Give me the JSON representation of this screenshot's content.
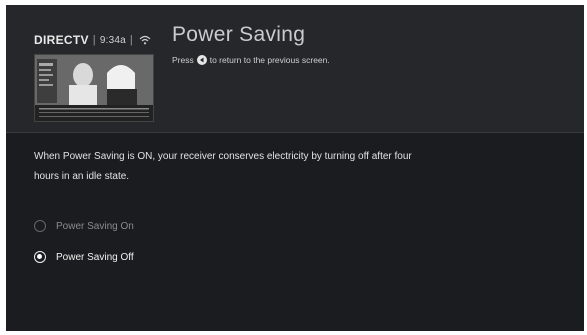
{
  "header": {
    "brand": "DIRECTV",
    "separator": "|",
    "time": "9:34a",
    "wifi_icon": "wifi-icon",
    "title": "Power Saving",
    "subtitle_prefix": "Press",
    "subtitle_suffix": "to return to the previous screen.",
    "back_icon": "back-arrow-icon"
  },
  "main": {
    "description": "When Power Saving is ON, your receiver conserves electricity by turning off after four hours in an idle state.",
    "options": [
      {
        "label": "Power Saving On",
        "selected": false
      },
      {
        "label": "Power Saving Off",
        "selected": true
      }
    ]
  },
  "colors": {
    "background": "#1b1c1f",
    "header_background": "#26272b",
    "selected_text": "#f1f1f1",
    "unselected_text": "#8a8b8e"
  }
}
